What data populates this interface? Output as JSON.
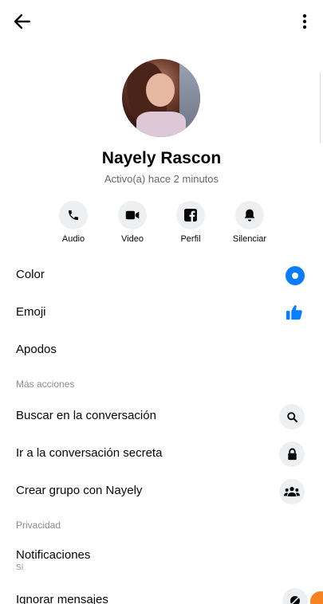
{
  "header": {
    "back_icon": "arrow-left-icon",
    "menu_icon": "more-vertical-icon"
  },
  "profile": {
    "name": "Nayely Rascon",
    "status": "Activo(a) hace 2 minutos"
  },
  "actions": [
    {
      "label": "Audio",
      "icon": "phone-icon"
    },
    {
      "label": "Video",
      "icon": "video-camera-icon"
    },
    {
      "label": "Perfil",
      "icon": "facebook-icon"
    },
    {
      "label": "Silenciar",
      "icon": "bell-icon"
    }
  ],
  "customize": {
    "color_label": "Color",
    "color_value": "#0a7cff",
    "emoji_label": "Emoji",
    "emoji_icon": "thumbs-up-icon",
    "nicknames_label": "Apodos"
  },
  "more_actions": {
    "section_title": "Más acciones",
    "items": [
      {
        "label": "Buscar en la conversación",
        "icon": "search-icon"
      },
      {
        "label": "Ir a la conversación secreta",
        "icon": "lock-icon"
      },
      {
        "label": "Crear grupo con Nayely",
        "icon": "group-icon"
      }
    ]
  },
  "privacy": {
    "section_title": "Privacidad",
    "notifications_label": "Notificaciones",
    "notifications_value": "Sí",
    "ignore_label": "Ignorar mensajes",
    "ignore_icon": "ignore-icon"
  }
}
